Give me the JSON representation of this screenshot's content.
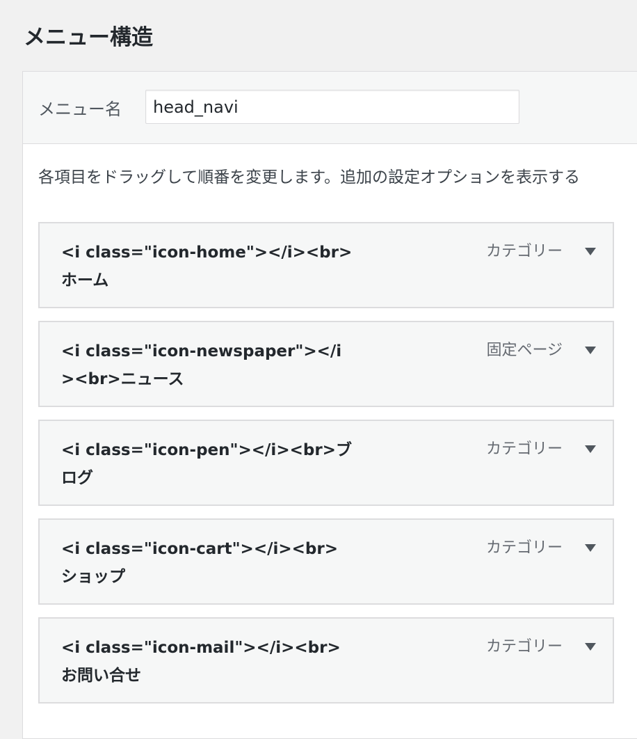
{
  "page": {
    "title": "メニュー構造"
  },
  "menu_name": {
    "label": "メニュー名",
    "value": "head_navi"
  },
  "instructions": "各項目をドラッグして順番を変更します。追加の設定オプションを表示する",
  "menu_items": [
    {
      "title": "<i class=\"icon-home\"></i><br>ホーム",
      "type": "カテゴリー"
    },
    {
      "title": "<i class=\"icon-newspaper\"></i><br>ニュース",
      "type": "固定ページ"
    },
    {
      "title": "<i class=\"icon-pen\"></i><br>ブログ",
      "type": "カテゴリー"
    },
    {
      "title": "<i class=\"icon-cart\"></i><br>ショップ",
      "type": "カテゴリー"
    },
    {
      "title": "<i class=\"icon-mail\"></i><br>お問い合せ",
      "type": "カテゴリー"
    }
  ],
  "icons": {
    "toggle": "triangle-down-icon"
  }
}
